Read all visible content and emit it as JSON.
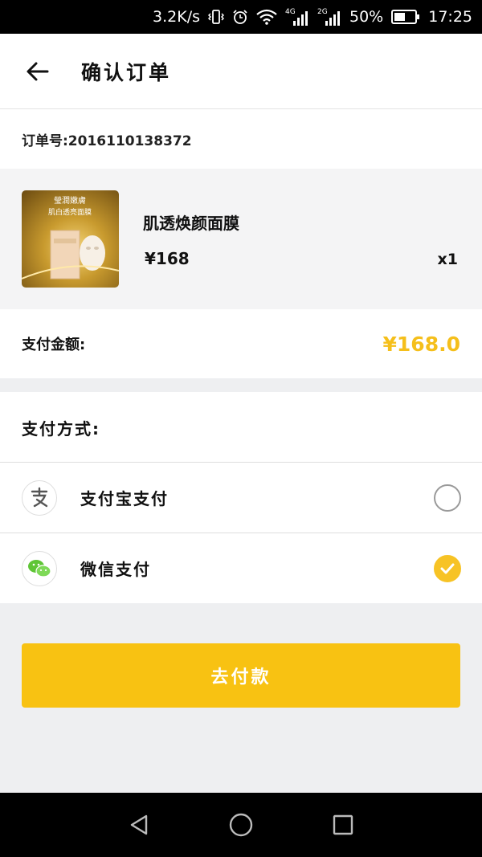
{
  "status_bar": {
    "net_speed": "3.2K/s",
    "net_4g": "4G",
    "net_2g": "2G",
    "battery": "50%",
    "time": "17:25"
  },
  "header": {
    "title": "确认订单",
    "back_icon": "arrow-left-icon"
  },
  "order": {
    "number_text": "订单号:2016110138372"
  },
  "product": {
    "name": "肌透焕颜面膜",
    "price": "¥168",
    "quantity": "x1",
    "thumb_text_1": "瑩潤嫩膚",
    "thumb_text_2": "肌白透亮面膜"
  },
  "amount": {
    "label": "支付金额:",
    "value": "¥168.0",
    "color": "#f5bf1b"
  },
  "payment": {
    "title": "支付方式:",
    "options": [
      {
        "label": "支付宝支付",
        "icon": "alipay-icon",
        "selected": false
      },
      {
        "label": "微信支付",
        "icon": "wechat-icon",
        "selected": true
      }
    ]
  },
  "actions": {
    "pay_label": "去付款",
    "accent": "#f8c212"
  },
  "nav": {
    "back_icon": "nav-back-icon",
    "home_icon": "nav-home-icon",
    "recents_icon": "nav-recents-icon"
  }
}
